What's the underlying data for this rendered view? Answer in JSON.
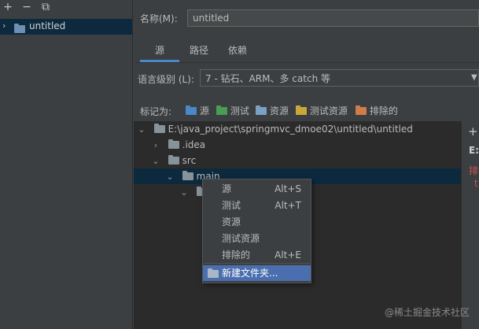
{
  "left_panel": {
    "toolbar": {
      "add_icon": "+",
      "remove_icon": "−",
      "copy_icon": "⧉"
    },
    "modules": [
      {
        "label": "untitled"
      }
    ]
  },
  "name_field": {
    "label": "名称(M):",
    "value": "untitled"
  },
  "tabs": [
    {
      "label": "源",
      "selected": true
    },
    {
      "label": "路径",
      "selected": false
    },
    {
      "label": "依赖",
      "selected": false
    }
  ],
  "language_level": {
    "label": "语言级别 (L):",
    "value": "7 - 钻石、ARM、多 catch 等"
  },
  "mark_as": {
    "label": "标记为:",
    "items": [
      {
        "label": "源",
        "color": "#4a88c7"
      },
      {
        "label": "测试",
        "color": "#499c54"
      },
      {
        "label": "资源",
        "color": "#7aa0c4"
      },
      {
        "label": "测试资源",
        "color": "#c9a83b"
      },
      {
        "label": "排除的",
        "color": "#d07d4a"
      }
    ]
  },
  "tree": {
    "root": "E:\\java_project\\springmvc_dmoe02\\untitled\\untitled",
    "idea": ".idea",
    "src": "src",
    "main": "main"
  },
  "right_strip": {
    "add": "+",
    "label": "E:\\",
    "red1": "排",
    "red2": "t"
  },
  "context_menu": {
    "items": [
      {
        "label": "源",
        "shortcut": "Alt+S"
      },
      {
        "label": "测试",
        "shortcut": "Alt+T"
      },
      {
        "label": "资源",
        "shortcut": ""
      },
      {
        "label": "测试资源",
        "shortcut": ""
      },
      {
        "label": "排除的",
        "shortcut": "Alt+E"
      }
    ],
    "new_folder": "新建文件夹..."
  },
  "watermark": "@稀土掘金技术社区",
  "colors": {
    "selection": "#0d293e",
    "menu_highlight": "#4b6eaf",
    "folder": "#87939a"
  }
}
